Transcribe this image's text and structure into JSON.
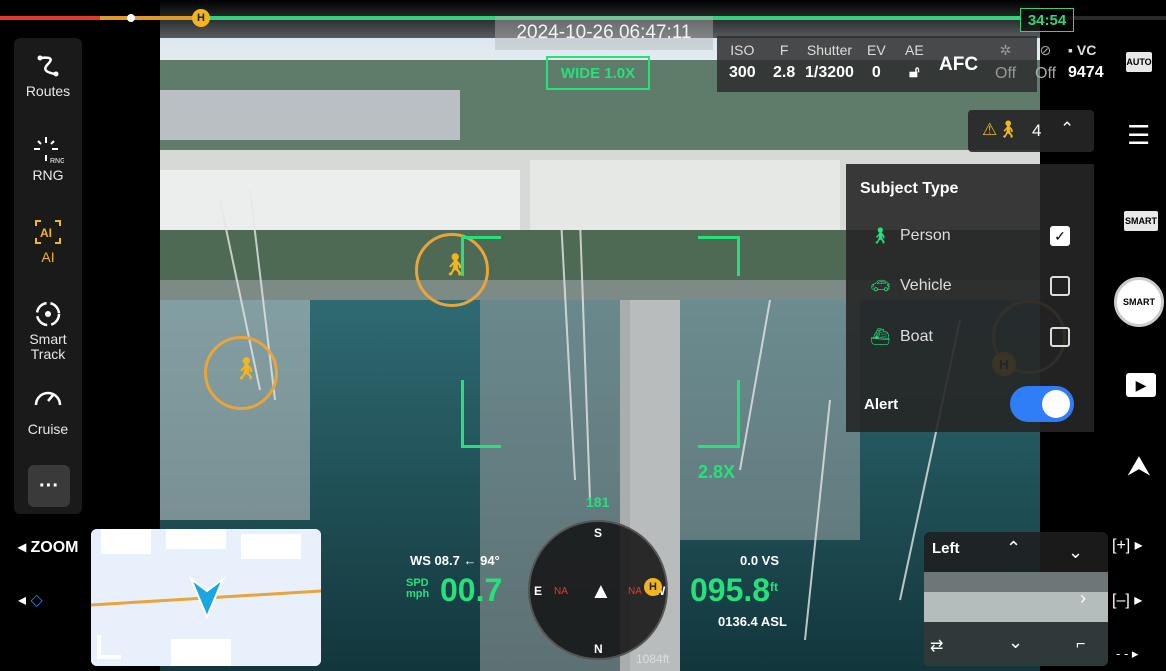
{
  "status": {
    "timestamp": "2024-10-26 06:47:11",
    "battery_time": "34:54",
    "home_badge": "H"
  },
  "zoom_indicator": "WIDE 1.0X",
  "camera_params": [
    {
      "label": "ISO",
      "value": "300"
    },
    {
      "label": "F",
      "value": "2.8"
    },
    {
      "label": "Shutter",
      "value": "1/3200"
    },
    {
      "label": "EV",
      "value": "0"
    },
    {
      "label": "AE",
      "value": ""
    },
    {
      "label": "",
      "value": "AFC"
    },
    {
      "label": "",
      "value": "Off"
    },
    {
      "label": "",
      "value": "Off"
    },
    {
      "label": "VC",
      "value": "9474"
    }
  ],
  "sidebar": {
    "items": [
      {
        "label": "Routes"
      },
      {
        "label": "RNG"
      },
      {
        "label": "AI"
      },
      {
        "label": "Smart Track"
      },
      {
        "label": "Cruise"
      }
    ],
    "more_label": "···"
  },
  "right_bar": {
    "auto_label": "AUTO",
    "smart_label": "SMART",
    "shutter_label": "SMART"
  },
  "subject_panel": {
    "count": "4",
    "title": "Subject Type",
    "items": [
      {
        "label": "Person",
        "checked": true
      },
      {
        "label": "Vehicle",
        "checked": false
      },
      {
        "label": "Boat",
        "checked": false
      }
    ],
    "alert_label": "Alert",
    "alert_on": true
  },
  "overlay": {
    "zoom_mark": "2.8X",
    "zoom_button": "ZOOM",
    "heading_num": "181"
  },
  "telemetry": {
    "ws": "WS 08.7",
    "wind_dir": "94°",
    "spd_label": "SPD",
    "spd_unit": "mph",
    "spd": "00.7",
    "alt": "095.8",
    "alt_unit": "ft",
    "vs": "0.0  VS",
    "asl": "0136.4 ASL",
    "dist": "1084ft"
  },
  "compass": {
    "n": "N",
    "s": "S",
    "e": "E",
    "w": "W",
    "na_left": "NA",
    "na_right": "NA"
  },
  "thumb": {
    "label": "Left"
  },
  "gimbal": {
    "plus": "[+]",
    "minus": "[–]",
    "more": "- -"
  },
  "colors": {
    "accent_green": "#26e07a",
    "orange": "#e9a43a",
    "blue": "#2f7ef7"
  }
}
